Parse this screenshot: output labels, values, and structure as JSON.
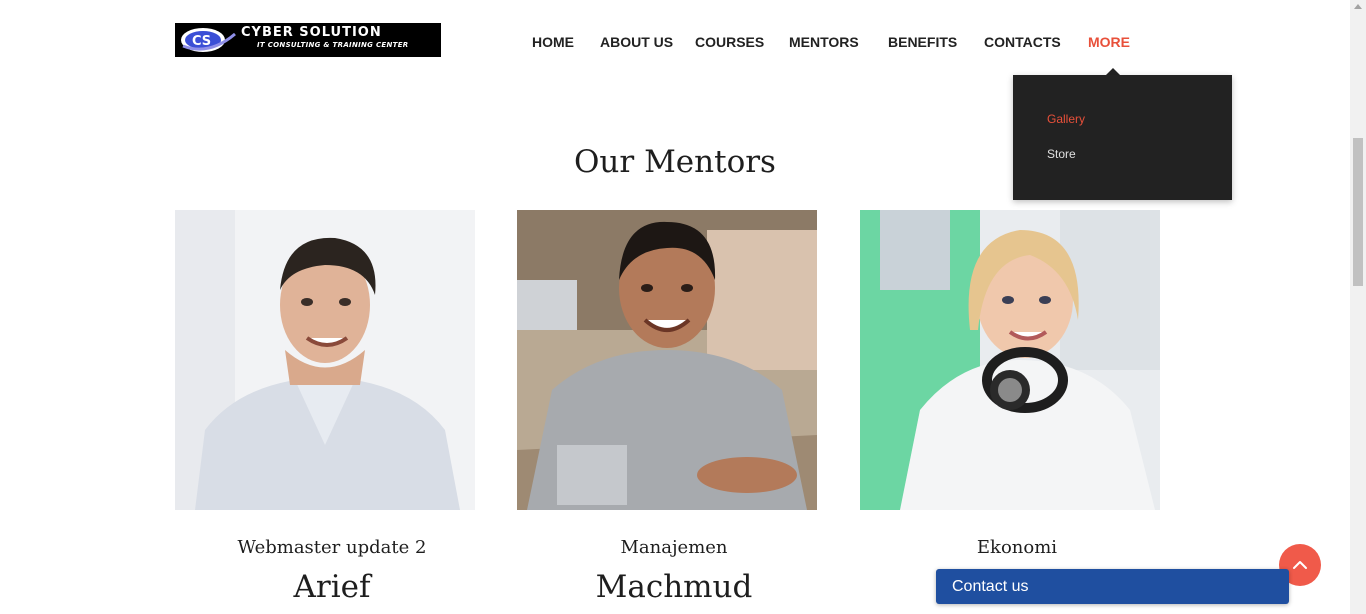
{
  "logo": {
    "title": "CYBER SOLUTION",
    "subtitle": "IT CONSULTING & TRAINING CENTER",
    "mark_text": "CS"
  },
  "nav": {
    "items": [
      "HOME",
      "ABOUT US",
      "COURSES",
      "MENTORS",
      "BENEFITS",
      "CONTACTS",
      "MORE"
    ],
    "active": "MORE"
  },
  "dropdown": {
    "items": [
      "Gallery",
      "Store"
    ],
    "active": "Gallery"
  },
  "section": {
    "title": "Our Mentors"
  },
  "mentors": [
    {
      "role": "Webmaster update 2",
      "name": "Arief"
    },
    {
      "role": "Manajemen",
      "name": "Machmud"
    },
    {
      "role": "Ekonomi",
      "name": ""
    }
  ],
  "contact": {
    "label": "Contact us"
  },
  "colors": {
    "accent": "#e8503a",
    "dropdown_bg": "#222222",
    "contact_bg": "#1f4fa0",
    "back_top": "#f05a4a"
  },
  "icons": {
    "back_to_top": "chevron-up-icon"
  }
}
